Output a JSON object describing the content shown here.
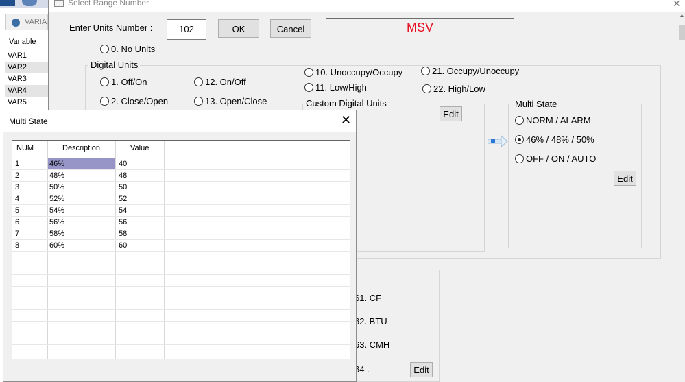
{
  "background_app": {
    "tab_label": "VARIA",
    "variable_column_header": "Variable",
    "variables": [
      "VAR1",
      "VAR2",
      "VAR3",
      "VAR4",
      "VAR5"
    ]
  },
  "dialog": {
    "title": "Select Range Number",
    "close_glyph": "✕",
    "units_label": "Enter Units Number :",
    "units_value": "102",
    "ok_label": "OK",
    "cancel_label": "Cancel",
    "current_unit": "MSV",
    "no_units_label": "0. No Units",
    "digital_units_title": "Digital Units",
    "digital_left_options": [
      "1. Off/On",
      "12. On/Off",
      "2. Close/Open",
      "13. Open/Close"
    ],
    "digital_right_options": [
      "10. Unoccupy/Occupy",
      "21. Occupy/Unoccupy",
      "11. Low/High",
      "22. High/Low"
    ],
    "custom_digital_title": "Custom Digital Units",
    "custom_edit_label": "Edit",
    "multi_state_title": "Multi State",
    "multi_state_options": [
      {
        "label": "NORM / ALARM",
        "checked": false
      },
      {
        "label": "46% / 48% / 50%",
        "checked": true
      },
      {
        "label": "OFF / ON / AUTO",
        "checked": false
      }
    ],
    "multi_state_edit_label": "Edit",
    "analog_items": [
      "61. CF",
      "62. BTU",
      "63. CMH",
      "64 ."
    ],
    "analog_edit_label": "Edit",
    "arrow_icon": "arrow-right-icon",
    "scroll_up_glyph": "▲"
  },
  "multi_state_popup": {
    "title": "Multi State",
    "close_glyph": "✕",
    "columns": [
      "NUM",
      "Description",
      "Value"
    ],
    "rows": [
      {
        "num": "1",
        "description": "46%",
        "value": "40"
      },
      {
        "num": "2",
        "description": "48%",
        "value": "48"
      },
      {
        "num": "3",
        "description": "50%",
        "value": "50"
      },
      {
        "num": "4",
        "description": "52%",
        "value": "52"
      },
      {
        "num": "5",
        "description": "54%",
        "value": "54"
      },
      {
        "num": "6",
        "description": "56%",
        "value": "56"
      },
      {
        "num": "7",
        "description": "58%",
        "value": "58"
      },
      {
        "num": "8",
        "description": "60%",
        "value": "60"
      }
    ]
  },
  "colors": {
    "current_unit_text": "#e81123",
    "selected_cell": "#9795c8",
    "arrow_blue": "#2b78d4"
  }
}
